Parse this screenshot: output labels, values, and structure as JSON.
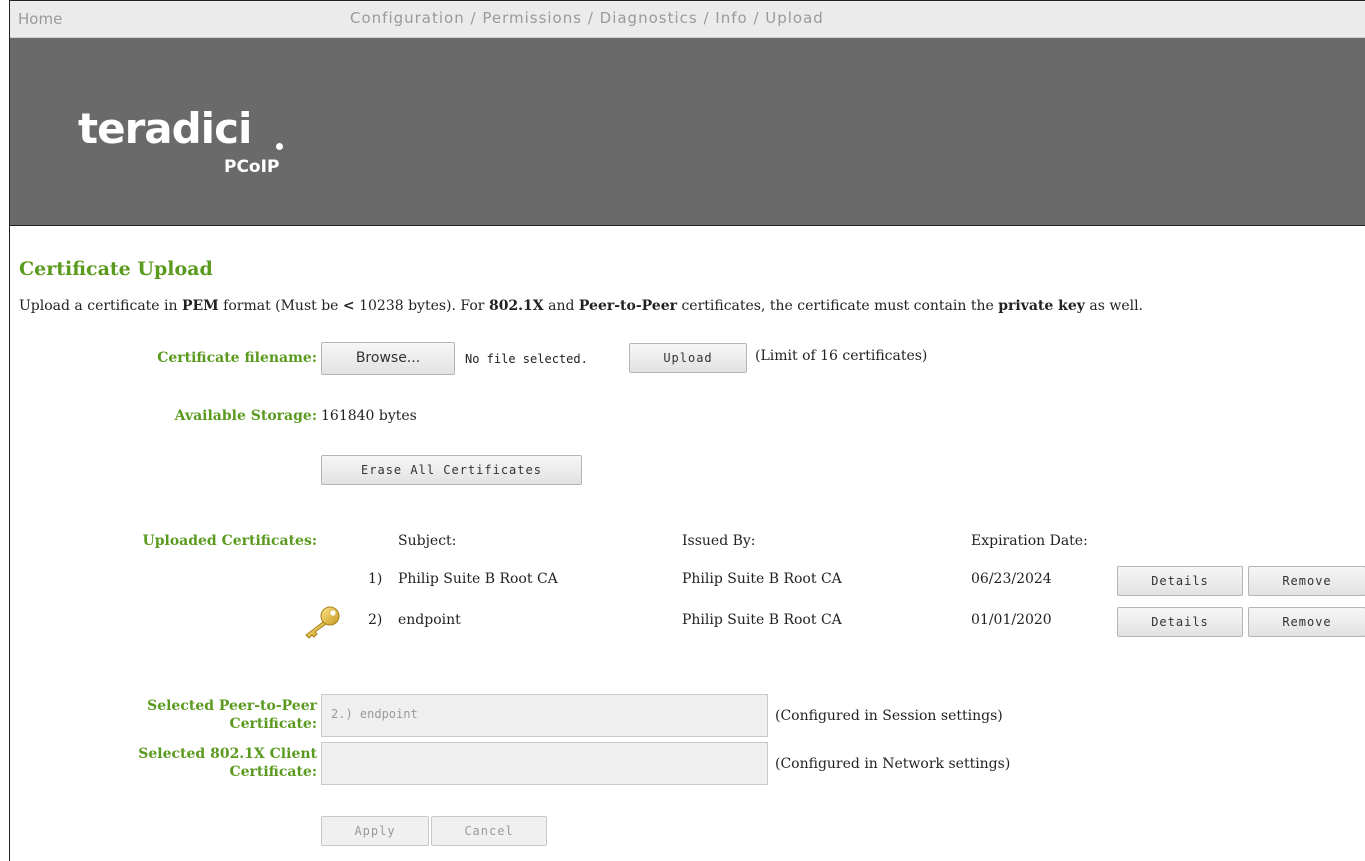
{
  "nav": {
    "home": "Home",
    "items": [
      "Configuration",
      "Permissions",
      "Diagnostics",
      "Info",
      "Upload"
    ],
    "separator": " / "
  },
  "logo": {
    "main": "teradici",
    "sub": "PCoIP"
  },
  "page": {
    "title": "Certificate Upload",
    "desc": {
      "p1": "Upload a certificate in ",
      "b1": "PEM",
      "p2": " format (Must be ",
      "b2": "<",
      "p3": " 10238 bytes). For ",
      "b3": "802.1X",
      "p4": " and ",
      "b4": "Peer-to-Peer",
      "p5": " certificates, the certificate must contain the ",
      "b5": "private key",
      "p6": " as well."
    }
  },
  "upload": {
    "label": "Certificate filename:",
    "browse": "Browse...",
    "file_status": "No file selected.",
    "upload_button": "Upload",
    "limit": "(Limit of 16 certificates)"
  },
  "storage": {
    "label": "Available Storage:",
    "value": "161840 bytes"
  },
  "erase_button": "Erase All Certificates",
  "certs": {
    "label": "Uploaded Certificates:",
    "headers": {
      "subject": "Subject:",
      "issued_by": "Issued By:",
      "expiration": "Expiration Date:"
    },
    "rows": [
      {
        "num": "1)",
        "subject": "Philip Suite B Root CA",
        "issuer": "Philip Suite B Root CA",
        "expires": "06/23/2024",
        "details": "Details",
        "remove": "Remove",
        "has_key": false
      },
      {
        "num": "2)",
        "subject": "endpoint",
        "issuer": "Philip Suite B Root CA",
        "expires": "01/01/2020",
        "details": "Details",
        "remove": "Remove",
        "has_key": true
      }
    ]
  },
  "selected": {
    "p2p_label_1": "Selected Peer-to-Peer",
    "p2p_label_2": "Certificate:",
    "p2p_value": "2.) endpoint",
    "p2p_note": "(Configured in Session settings)",
    "x_label_1": "Selected 802.1X Client",
    "x_label_2": "Certificate:",
    "x_value": "",
    "x_note": "(Configured in Network settings)"
  },
  "actions": {
    "apply": "Apply",
    "cancel": "Cancel"
  },
  "colors": {
    "accent": "#5a9a1e",
    "banner": "#6a6a6a",
    "nav_bg": "#ebebeb"
  }
}
